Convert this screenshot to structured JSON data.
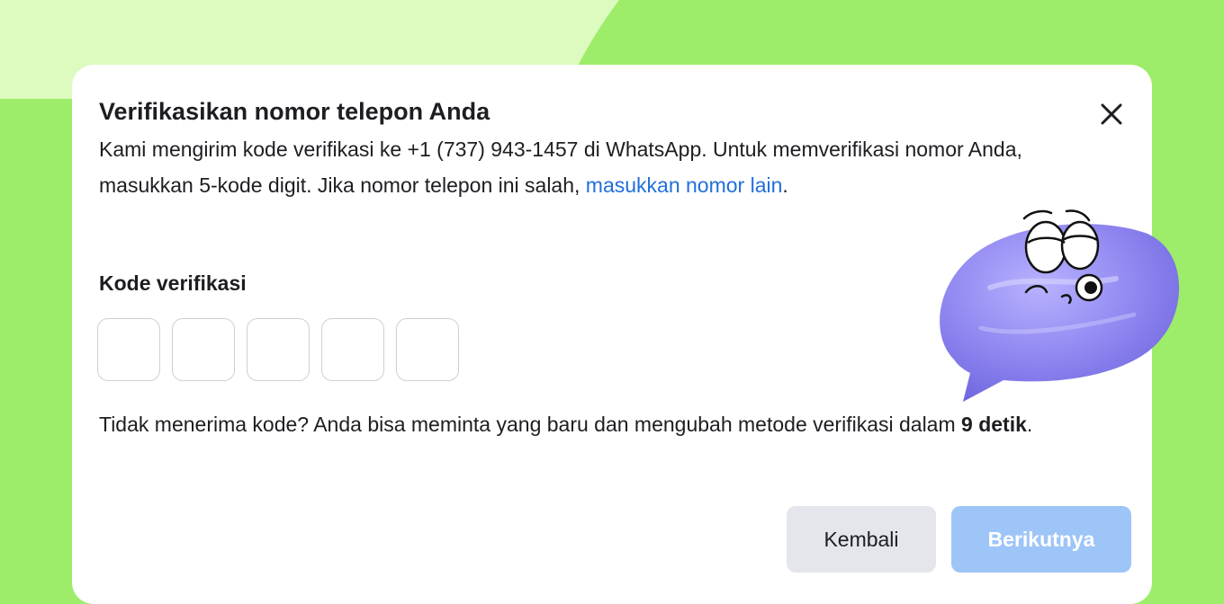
{
  "background": {
    "base_color": "#9ded6a",
    "accent_color": "#ddfabf"
  },
  "dialog": {
    "title": "Verifikasikan nomor telepon Anda",
    "close_icon": "close-icon",
    "description_before_link": "Kami mengirim kode verifikasi ke +1 (737) 943-1457 di WhatsApp. Untuk memverifikasi nomor Anda, masukkan 5-kode digit. Jika nomor telepon ini salah, ",
    "description_link": "masukkan nomor lain",
    "description_after_link": ".",
    "code_label": "Kode verifikasi",
    "code_digits": [
      "",
      "",
      "",
      "",
      ""
    ],
    "resend_text_before": "Tidak menerima kode? Anda bisa meminta yang baru dan mengubah metode verifikasi dalam ",
    "resend_countdown": "9 detik",
    "resend_text_after": ".",
    "back_button": "Kembali",
    "next_button": "Berikutnya",
    "colors": {
      "link": "#216fdb",
      "next_button_disabled": "#9ec5f8",
      "back_button": "#e4e6eb"
    }
  },
  "mascot": {
    "icon": "speech-bubble-mascot-icon",
    "color": "#8f86f0"
  }
}
